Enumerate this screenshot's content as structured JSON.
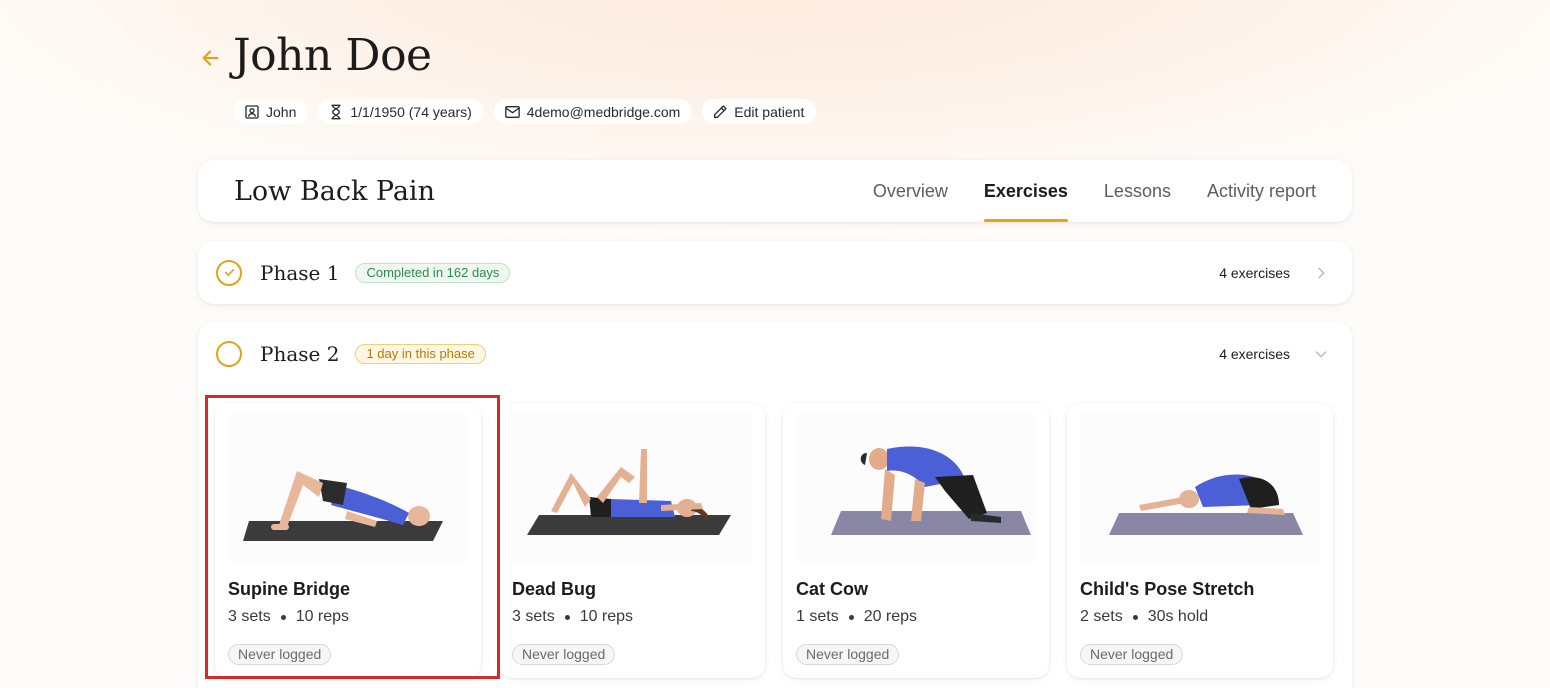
{
  "patient": {
    "name": "John Doe",
    "chips": {
      "first_name": "John",
      "dob": "1/1/1950 (74 years)",
      "email": "4demo@medbridge.com",
      "edit": "Edit patient"
    }
  },
  "program": {
    "title": "Low Back Pain",
    "tabs": [
      "Overview",
      "Exercises",
      "Lessons",
      "Activity report"
    ],
    "active_tab": "Exercises"
  },
  "phases": [
    {
      "title": "Phase 1",
      "badge": "Completed in 162 days",
      "count": "4 exercises",
      "status": "completed",
      "expanded": false
    },
    {
      "title": "Phase 2",
      "badge": "1 day in this phase",
      "count": "4 exercises",
      "status": "in-progress",
      "expanded": true
    }
  ],
  "exercises": [
    {
      "name": "Supine Bridge",
      "sets": "3 sets",
      "detail": "10 reps",
      "log": "Never logged",
      "selected": true
    },
    {
      "name": "Dead Bug",
      "sets": "3 sets",
      "detail": "10 reps",
      "log": "Never logged",
      "selected": false
    },
    {
      "name": "Cat Cow",
      "sets": "1 sets",
      "detail": "20 reps",
      "log": "Never logged",
      "selected": false
    },
    {
      "name": "Child's Pose Stretch",
      "sets": "2 sets",
      "detail": "30s hold",
      "log": "Never logged",
      "selected": false
    }
  ],
  "colors": {
    "accent": "#e8a317",
    "selection_outline": "#d42a2a",
    "completed_badge": "#2e8a4f",
    "phase_badge": "#b57a07"
  }
}
